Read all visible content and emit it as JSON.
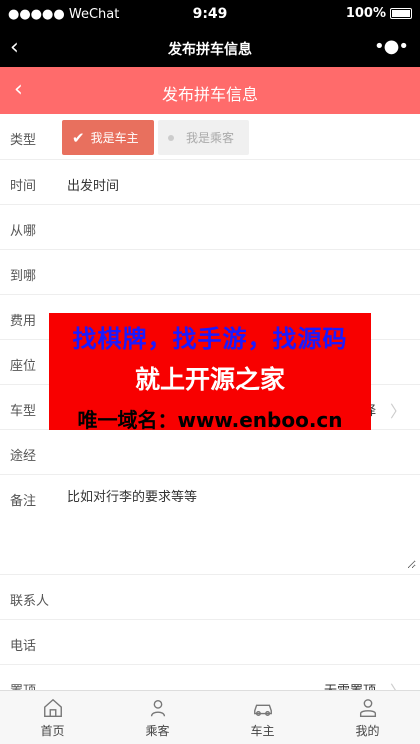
{
  "status": {
    "carrier": "●●●●● WeChat",
    "time": "9:49",
    "battery": "100%"
  },
  "wechat_nav": {
    "back_icon": "‹",
    "title": "发布拼车信息",
    "more_icon": "•●•"
  },
  "header": {
    "back_icon": "‹",
    "title": "发布拼车信息",
    "color": "#ff6b6b"
  },
  "form": {
    "type": {
      "label": "类型",
      "options": [
        "我是车主",
        "我是乘客"
      ],
      "selected": "我是车主"
    },
    "time": {
      "label": "时间",
      "placeholder": "出发时间"
    },
    "from": {
      "label": "从哪"
    },
    "to": {
      "label": "到哪"
    },
    "fee": {
      "label": "费用"
    },
    "seats": {
      "label": "座位"
    },
    "car_type": {
      "label": "车型",
      "value_fragment": "择"
    },
    "via": {
      "label": "途经"
    },
    "note": {
      "label": "备注",
      "placeholder": "比如对行李的要求等等"
    },
    "contact": {
      "label": "联系人"
    },
    "phone": {
      "label": "电话"
    },
    "pin": {
      "label": "置顶",
      "value": "无需置顶"
    }
  },
  "ad": {
    "line1": "找棋牌，找手游，找源码",
    "line2": "就上开源之家",
    "line3": "唯一域名：www.enboo.cn"
  },
  "tabbar": [
    {
      "label": "首页",
      "icon": "home-icon"
    },
    {
      "label": "乘客",
      "icon": "person-icon"
    },
    {
      "label": "车主",
      "icon": "car-icon"
    },
    {
      "label": "我的",
      "icon": "user-icon"
    }
  ]
}
